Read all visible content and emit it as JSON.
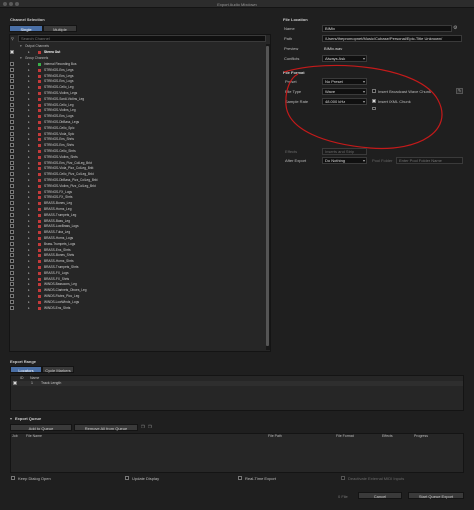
{
  "window": {
    "title": "Export Audio Mixdown"
  },
  "channel_selection": {
    "header": "Channel Selection",
    "tabs": [
      "Single",
      "Multiple"
    ],
    "search_placeholder": "Search Channel",
    "output_group": "Output Channels",
    "stereo_out": "Stereo Out",
    "group_label": "Group Channels",
    "channels": [
      "Internal Recording Bus",
      "STRINGS-Ens_Legs",
      "STRINGS-Ens_Legs",
      "STRINGS-Ens_Logs",
      "STRINGS-Cello_Leg",
      "STRINGS-Violins_Legs",
      "STRINGS-Sordi-Violins_Leg",
      "STRINGS-Cello_Leg",
      "STRINGS-Violins_Leg",
      "STRINGS-Ens_Logs",
      "STRINGS-DbBass_Legs",
      "STRINGS-Cello_Spic",
      "STRINGS-Viola_Spic",
      "STRINGS-Ens_Shrts",
      "STRINGS-Ens_Shrts",
      "STRINGS-Cello_Shrts",
      "STRINGS-Violins_Shrts",
      "STRINGS-Ens_Pizz_ColLeg_Brkt",
      "STRINGS-Viola_Pizz_ColLeg_Brkt",
      "STRINGS-Cello_Pizz_ColLeg_Brkt",
      "STRINGS-DbBass_Pizz_ColLeg_Brkt",
      "STRINGS-Violins_Pizz_ColLeg_Brkt",
      "STRINGS-FX_Logs",
      "STRINGS-FX_Shrts",
      "BRASS-Bones_Leg",
      "BRASS-Horns_Leg",
      "BRASS-Trumpets_Leg",
      "BRASS-Bass_Leg",
      "BRASS-LowBrass_Logs",
      "BRASS-Tuba_Leg",
      "BRASS-Horns_Logs",
      "Brass-Trumpets_Logs",
      "BRASS-Ens_Shrts",
      "BRASS-Bones_Shrts",
      "BRASS-Horns_Shrts",
      "BRASS-Trumpets_Shrts",
      "BRASS-FX_Logs",
      "BRASS-FX_Shrts",
      "WINDS-Bassoons_Leg",
      "WINDS-Clarinets_Oboes_Leg",
      "WINDS-Flutes_Picc_Leg",
      "WINDS-LowWinds_Logs",
      "WINDS-Ens_Shrts"
    ]
  },
  "file_location": {
    "header": "File Location",
    "name_label": "Name",
    "name_value": "BIMix",
    "path_label": "Path",
    "path_value": "/Users/thepromopnet/Music/Cubase/Personal/Epic-Title Unknown/",
    "preview_label": "Preview",
    "preview_value": "BIMix.wav",
    "conflicts_label": "Conflicts",
    "conflicts_value": "Always Ask"
  },
  "file_format": {
    "header": "File Format",
    "preset_label": "Preset",
    "preset_value": "No Preset",
    "filetype_label": "File Type",
    "filetype_value": "Wave",
    "samplerate_label": "Sample Rate",
    "samplerate_value": "48.000 kHz",
    "broadcast_label": "Insert Broadcast Wave Chunk",
    "ixml_label": "Insert iXML Chunk"
  },
  "effects": {
    "label": "Effects",
    "value": "Inserts and Strip"
  },
  "after_export": {
    "label": "After Export",
    "value": "Do Nothing",
    "pool_folder_label": "Pool Folder",
    "pool_folder_placeholder": "Enter Pool Folder Name"
  },
  "export_range": {
    "header": "Export Range",
    "tabs": [
      "Locators",
      "Cycle Markers"
    ],
    "col_id": "ID",
    "col_name": "Name",
    "rows": [
      {
        "id": "1",
        "name": "Track Length"
      }
    ]
  },
  "export_queue": {
    "header": "Export Queue",
    "add_button": "Add to Queue",
    "remove_button": "Remove All from Queue",
    "columns": [
      "Job",
      "File Name",
      "File Path",
      "File Format",
      "Effects",
      "Progress"
    ]
  },
  "bottom": {
    "keep_dialog": "Keep Dialog Open",
    "update_display": "Update Display",
    "realtime_export": "Real-Time Export",
    "deactivate_midi": "Deactivate External MIDI Inputs",
    "file_count": "0 File",
    "cancel_button": "Cancel",
    "start_button": "Start Queue Export"
  },
  "colors": {
    "selected_tab": "#4a6fa5",
    "annotation": "#c41a1a",
    "dot_red": "#c43a3a",
    "dot_green": "#3ab04a"
  }
}
